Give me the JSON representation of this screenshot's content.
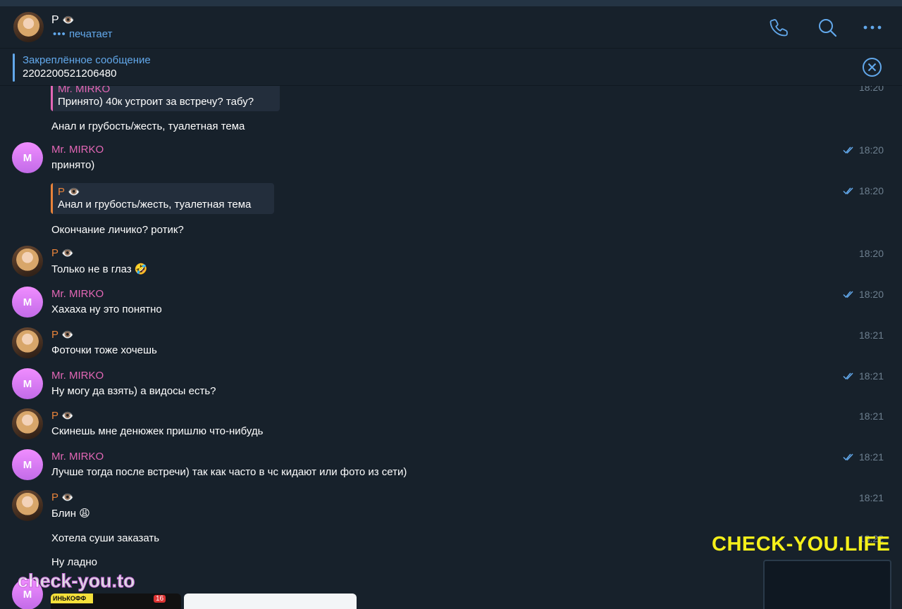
{
  "header": {
    "name": "Р",
    "status": "печатает",
    "colors": {
      "accent": "#62a8eb",
      "background": "#17212b"
    }
  },
  "pinned": {
    "title": "Закреплённое сообщение",
    "text": "2202200521206480"
  },
  "messages": [
    {
      "id": "q1",
      "quote_name": "Mr. MIRKO",
      "quote_text": "Принято) 40к устроит за встречу? табу?",
      "time": "18:20"
    },
    {
      "id": "t1",
      "text": "Анал и грубость/жесть, туалетная тема"
    },
    {
      "id": "m1",
      "name": "Mr. MIRKO",
      "text": "принято)",
      "time": "18:20",
      "read": true
    },
    {
      "id": "q2",
      "quote_name": "Р",
      "quote_text": "Анал и грубость/жесть, туалетная тема",
      "time": "18:20",
      "read": true
    },
    {
      "id": "t2",
      "text": "Окончание личико? ротик?"
    },
    {
      "id": "p1",
      "name": "Р",
      "text": "Только не в глаз 🤣",
      "time": "18:20"
    },
    {
      "id": "m2",
      "name": "Mr. MIRKO",
      "text": "Хахаха ну это понятно",
      "time": "18:20",
      "read": true
    },
    {
      "id": "p2",
      "name": "Р",
      "text": "Фоточки тоже хочешь",
      "time": "18:21"
    },
    {
      "id": "m3",
      "name": "Mr. MIRKO",
      "text": "Ну могу да взять) а видосы есть?",
      "time": "18:21",
      "read": true
    },
    {
      "id": "p3",
      "name": "Р",
      "text": "Скинешь мне денюжек пришлю что-нибудь",
      "time": "18:21"
    },
    {
      "id": "m4",
      "name": "Mr. MIRKO",
      "text": "Лучше тогда после встречи) так как часто в чс кидают или фото из сети)",
      "time": "18:21",
      "read": true
    },
    {
      "id": "p4",
      "name": "Р",
      "text": "Блин 😩",
      "time": "18:21"
    },
    {
      "id": "t3",
      "text": "Хотела суши заказать",
      "time": "18:22"
    },
    {
      "id": "t4",
      "text": "Ну ладно"
    }
  ],
  "avatar_letter": "M",
  "watermarks": {
    "big": "CHECK-YOU.LIFE",
    "small": "check-you.to"
  },
  "image_preview": {
    "label": "ИНЬКОФФ",
    "badge": "16"
  }
}
